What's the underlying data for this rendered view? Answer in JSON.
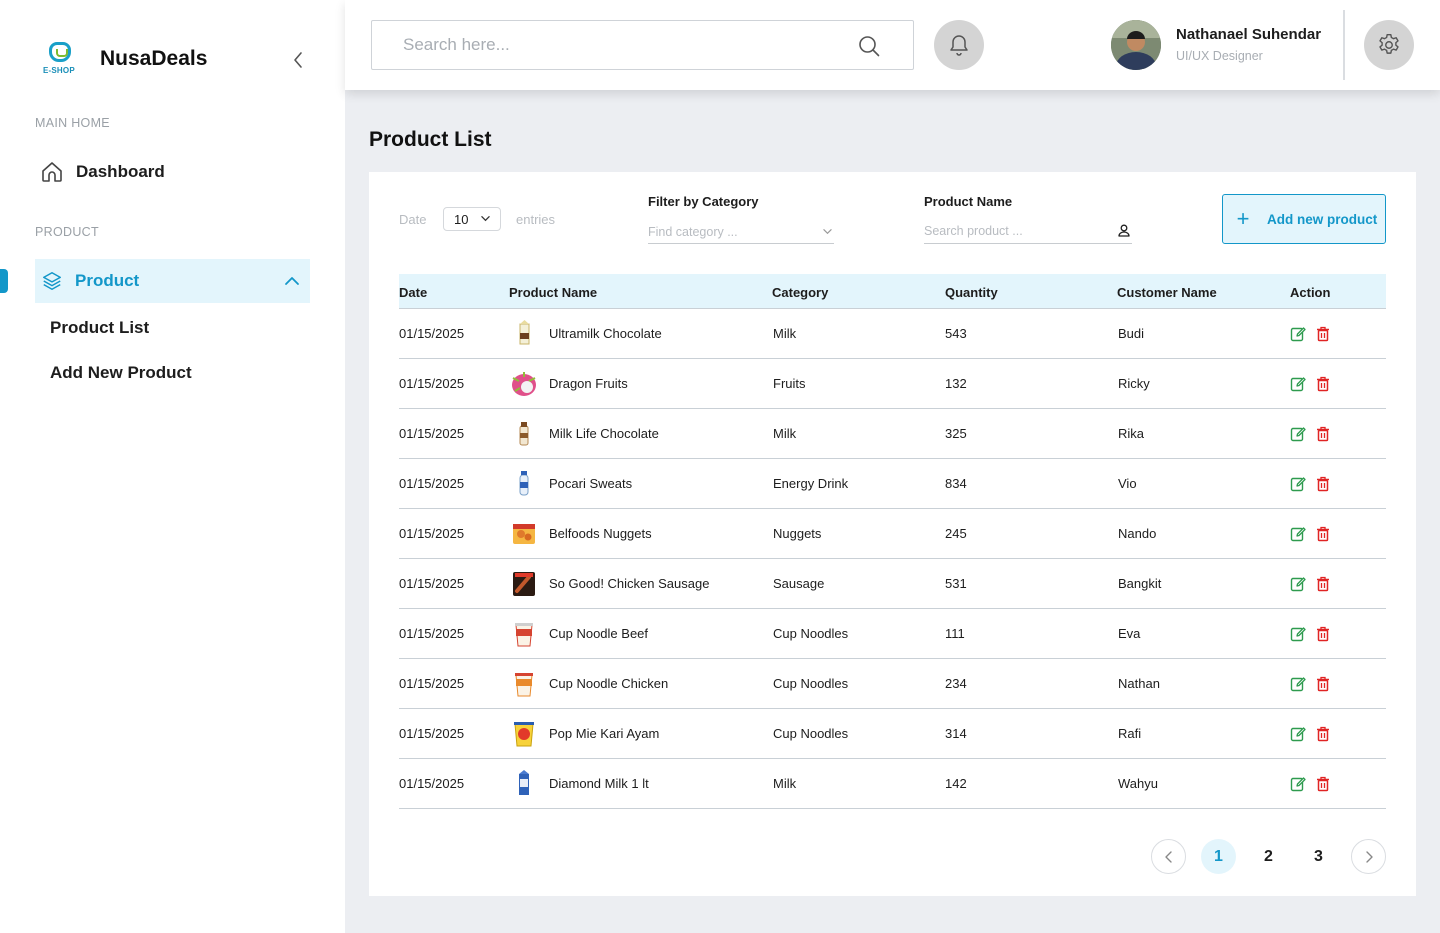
{
  "brand": {
    "name": "NusaDeals",
    "logo_text": "E-SHOP"
  },
  "sidebar": {
    "section_main": "MAIN HOME",
    "dashboard_label": "Dashboard",
    "section_product": "PRODUCT",
    "product_label": "Product",
    "sub_items": [
      "Product List",
      "Add New Product"
    ]
  },
  "header": {
    "search_placeholder": "Search here...",
    "user_name": "Nathanael Suhendar",
    "user_role": "UI/UX Designer"
  },
  "page": {
    "title": "Product List"
  },
  "filters": {
    "date_label": "Date",
    "entries_value": "10",
    "entries_label": "entries",
    "category_label": "Filter by Category",
    "category_placeholder": "Find category ...",
    "name_label": "Product Name",
    "name_placeholder": "Search product ...",
    "add_button": "Add new product"
  },
  "table": {
    "columns": [
      "Date",
      "Product Name",
      "Category",
      "Quantity",
      "Customer Name",
      "Action"
    ],
    "rows": [
      {
        "date": "01/15/2025",
        "name": "Ultramilk Chocolate",
        "category": "Milk",
        "quantity": "543",
        "customer": "Budi",
        "thumb": "milk-carton"
      },
      {
        "date": "01/15/2025",
        "name": "Dragon Fruits",
        "category": "Fruits",
        "quantity": "132",
        "customer": "Ricky",
        "thumb": "dragon-fruit"
      },
      {
        "date": "01/15/2025",
        "name": "Milk Life Chocolate",
        "category": "Milk",
        "quantity": "325",
        "customer": "Rika",
        "thumb": "milk-bottle"
      },
      {
        "date": "01/15/2025",
        "name": "Pocari Sweats",
        "category": "Energy Drink",
        "quantity": "834",
        "customer": "Vio",
        "thumb": "drink-bottle"
      },
      {
        "date": "01/15/2025",
        "name": "Belfoods Nuggets",
        "category": "Nuggets",
        "quantity": "245",
        "customer": "Nando",
        "thumb": "nugget-pack"
      },
      {
        "date": "01/15/2025",
        "name": "So Good! Chicken Sausage",
        "category": "Sausage",
        "quantity": "531",
        "customer": "Bangkit",
        "thumb": "sausage-pack"
      },
      {
        "date": "01/15/2025",
        "name": "Cup Noodle Beef",
        "category": "Cup Noodles",
        "quantity": "111",
        "customer": "Eva",
        "thumb": "cup-noodle-red"
      },
      {
        "date": "01/15/2025",
        "name": "Cup Noodle Chicken",
        "category": "Cup Noodles",
        "quantity": "234",
        "customer": "Nathan",
        "thumb": "cup-noodle-orange"
      },
      {
        "date": "01/15/2025",
        "name": "Pop Mie Kari Ayam",
        "category": "Cup Noodles",
        "quantity": "314",
        "customer": "Rafi",
        "thumb": "cup-noodle-yellow"
      },
      {
        "date": "01/15/2025",
        "name": "Diamond Milk 1 lt",
        "category": "Milk",
        "quantity": "142",
        "customer": "Wahyu",
        "thumb": "milk-carton-blue"
      }
    ]
  },
  "pagination": {
    "pages": [
      "1",
      "2",
      "3"
    ],
    "current": "1"
  },
  "colors": {
    "accent": "#1397c9",
    "accent_light": "#e3f5fc",
    "edit": "#2e9b4f",
    "delete": "#e02424",
    "background": "#eceef2"
  }
}
